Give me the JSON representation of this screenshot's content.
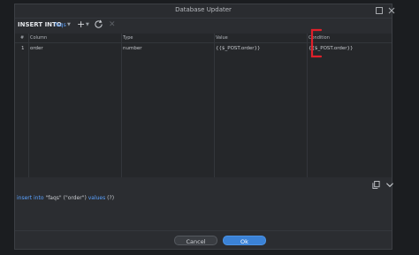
{
  "window": {
    "title": "Database Updater"
  },
  "toolbar": {
    "label": "INSERT INTO",
    "table": "faqs"
  },
  "grid": {
    "headers": {
      "index": "#",
      "column": "Column",
      "type": "Type",
      "value": "Value",
      "condition": "Condition"
    },
    "rows": [
      {
        "index": "1",
        "column": "order",
        "type": "number",
        "value": "{{$_POST.order}}",
        "condition": "{{$_POST.order}}"
      }
    ]
  },
  "sql": {
    "kw1": "insert into",
    "table": "\"faqs\"",
    "cols": "(\"order\")",
    "kw2": "values",
    "params": "(?)"
  },
  "buttons": {
    "cancel": "Cancel",
    "ok": "Ok"
  },
  "colors": {
    "accent": "#3b82d6",
    "annotation": "#e0202a"
  }
}
